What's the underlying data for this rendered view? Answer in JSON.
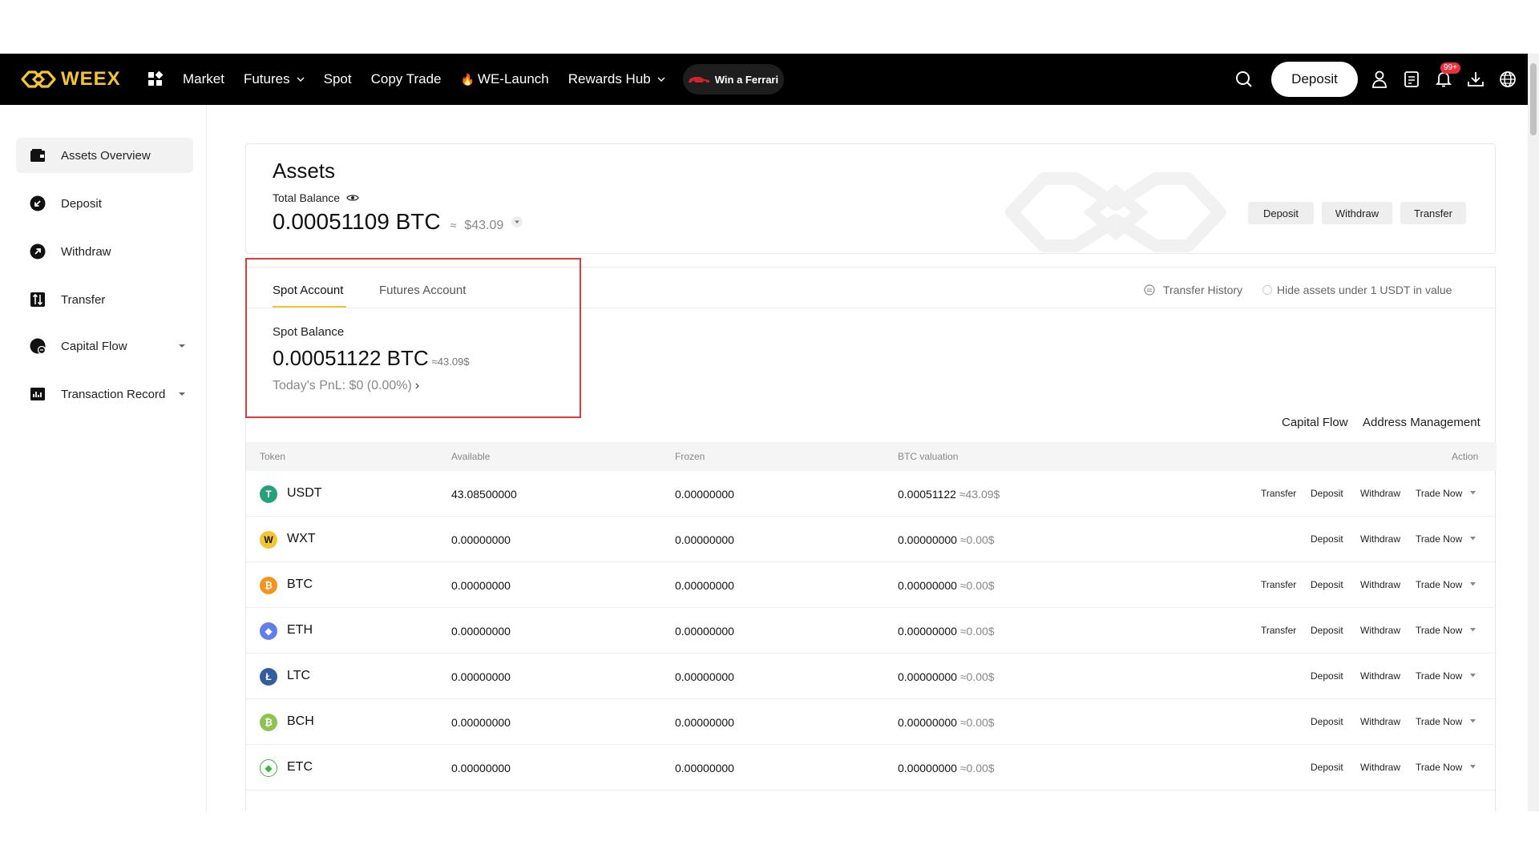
{
  "nav": {
    "logo_text": "WEEX",
    "items": [
      {
        "label": "Market"
      },
      {
        "label": "Futures"
      },
      {
        "label": "Spot"
      },
      {
        "label": "Copy Trade"
      },
      {
        "label": "WE-Launch"
      },
      {
        "label": "Rewards Hub"
      }
    ],
    "promo_label": "Win a Ferrari",
    "deposit_label": "Deposit",
    "notification_badge": "99+",
    "accent_color": "#f3c531"
  },
  "sidebar": {
    "items": [
      {
        "label": "Assets Overview",
        "icon": "wallet-icon"
      },
      {
        "label": "Deposit",
        "icon": "deposit-arrow-icon"
      },
      {
        "label": "Withdraw",
        "icon": "withdraw-arrow-icon"
      },
      {
        "label": "Transfer",
        "icon": "transfer-icon"
      },
      {
        "label": "Capital Flow",
        "icon": "capital-flow-icon"
      },
      {
        "label": "Transaction Record",
        "icon": "chart-icon"
      }
    ]
  },
  "assets": {
    "title": "Assets",
    "total_label": "Total Balance",
    "total_btc": "0.00051109 BTC",
    "approx": "≈",
    "total_usd": "$43.09",
    "buttons": {
      "deposit": "Deposit",
      "withdraw": "Withdraw",
      "transfer": "Transfer"
    }
  },
  "spot": {
    "tabs": [
      "Spot Account",
      "Futures Account"
    ],
    "transfer_history": "Transfer History",
    "hide_small": "Hide assets under 1 USDT in value",
    "balance_label": "Spot Balance",
    "balance_btc": "0.00051122 BTC",
    "balance_usd": "≈43.09$",
    "pnl": "Today's PnL: $0 (0.00%)",
    "links": {
      "capital_flow": "Capital Flow",
      "address_management": "Address Management"
    }
  },
  "table": {
    "headers": {
      "token": "Token",
      "available": "Available",
      "frozen": "Frozen",
      "btc_valuation": "BTC valuation",
      "action": "Action"
    },
    "action_labels": {
      "transfer": "Transfer",
      "deposit": "Deposit",
      "withdraw": "Withdraw",
      "trade_now": "Trade Now"
    },
    "rows": [
      {
        "symbol": "USDT",
        "available": "43.08500000",
        "frozen": "0.00000000",
        "btc_val": "0.00051122",
        "usd_val": "≈43.09$",
        "color": "#26a17b",
        "glyph": "T"
      },
      {
        "symbol": "WXT",
        "available": "0.00000000",
        "frozen": "0.00000000",
        "btc_val": "0.00000000",
        "usd_val": "≈0.00$",
        "color": "#f3c531",
        "glyph": "W"
      },
      {
        "symbol": "BTC",
        "available": "0.00000000",
        "frozen": "0.00000000",
        "btc_val": "0.00000000",
        "usd_val": "≈0.00$",
        "color": "#f7931a",
        "glyph": "₿"
      },
      {
        "symbol": "ETH",
        "available": "0.00000000",
        "frozen": "0.00000000",
        "btc_val": "0.00000000",
        "usd_val": "≈0.00$",
        "color": "#627eea",
        "glyph": "◆"
      },
      {
        "symbol": "LTC",
        "available": "0.00000000",
        "frozen": "0.00000000",
        "btc_val": "0.00000000",
        "usd_val": "≈0.00$",
        "color": "#345d9d",
        "glyph": "Ł"
      },
      {
        "symbol": "BCH",
        "available": "0.00000000",
        "frozen": "0.00000000",
        "btc_val": "0.00000000",
        "usd_val": "≈0.00$",
        "color": "#8dc351",
        "glyph": "₿"
      },
      {
        "symbol": "ETC",
        "available": "0.00000000",
        "frozen": "0.00000000",
        "btc_val": "0.00000000",
        "usd_val": "≈0.00$",
        "color": "#3ab83a",
        "glyph": "◆"
      }
    ]
  }
}
